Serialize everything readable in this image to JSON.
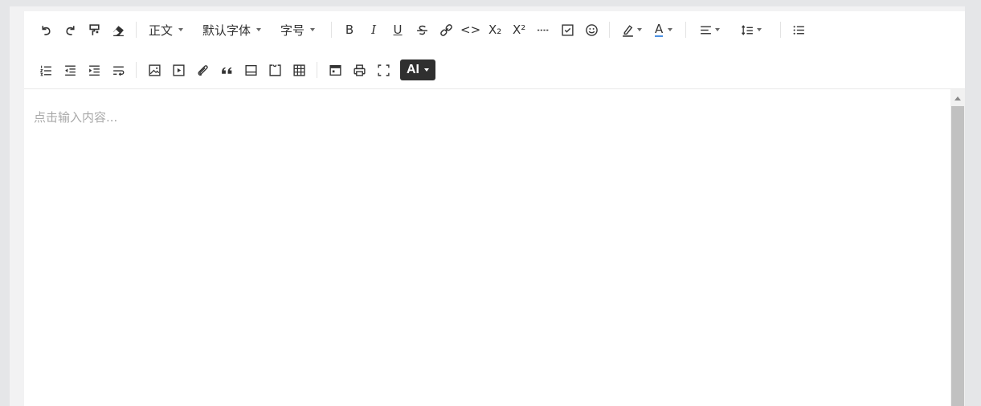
{
  "toolbar": {
    "row1": {
      "paragraph_style": "正文",
      "font_family": "默认字体",
      "font_size": "字号",
      "bold": "B",
      "italic": "I",
      "underline": "U",
      "code": "<>",
      "subscript": "X₂",
      "superscript": "X²",
      "font_color": "A"
    },
    "row2": {
      "ai_label": "AI"
    },
    "icons": [
      "undo-icon",
      "redo-icon",
      "format-painter-icon",
      "eraser-icon",
      "strikethrough-icon",
      "link-icon",
      "horizontal-rule-icon",
      "task-list-icon",
      "emoji-icon",
      "highlight-icon",
      "align-icon",
      "line-height-icon",
      "bulleted-list-icon",
      "numbered-list-icon",
      "outdent-icon",
      "indent-icon",
      "wrap-icon",
      "image-icon",
      "video-icon",
      "attachment-icon",
      "quote-icon",
      "code-block-icon",
      "container-icon",
      "table-icon",
      "template-icon",
      "print-icon",
      "fullscreen-icon"
    ]
  },
  "content": {
    "placeholder": "点击输入内容..."
  }
}
